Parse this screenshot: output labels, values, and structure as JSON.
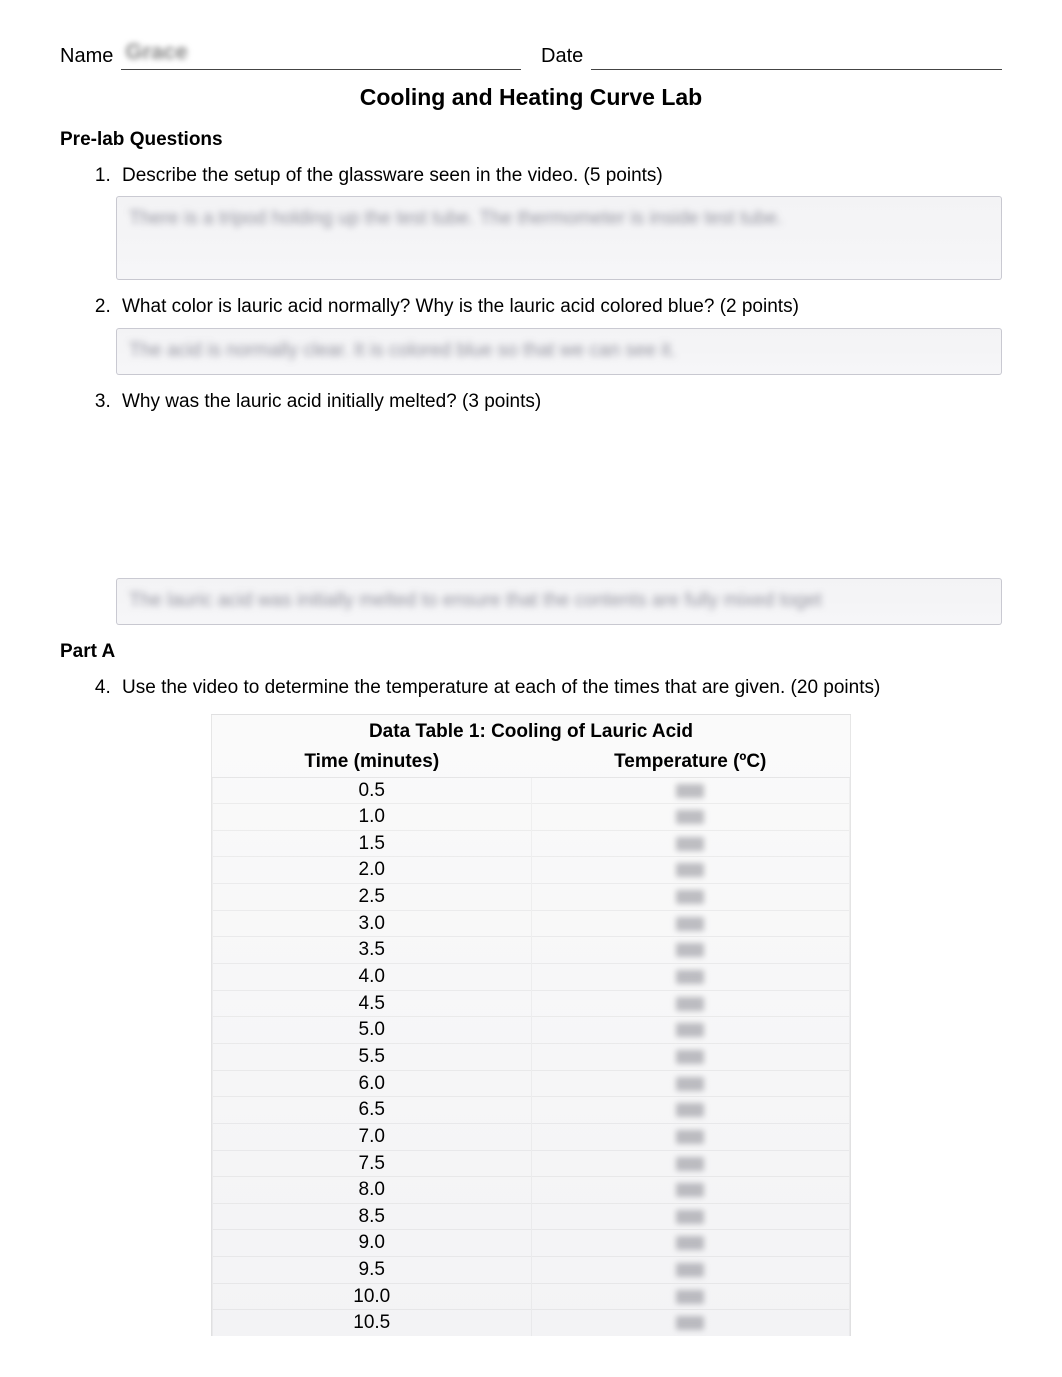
{
  "header": {
    "name_label": "Name",
    "name_value": "Grace",
    "date_label": "Date",
    "date_value": ""
  },
  "title": "Cooling and Heating Curve Lab",
  "sections": {
    "prelab_heading": "Pre-lab Questions",
    "parta_heading": "Part A"
  },
  "questions": {
    "q1": {
      "text": "Describe the setup of the glassware seen in the video. (5 points)",
      "answer": "There is a tripod holding up the test tube. The thermometer is inside test tube."
    },
    "q2": {
      "text": "What color is lauric acid normally? Why is the lauric acid colored blue? (2 points)",
      "answer": "The acid is normally clear. It is colored blue so that we can see it."
    },
    "q3": {
      "text": "Why was the lauric acid initially melted? (3 points)",
      "answer": "The lauric acid was initially melted to ensure that the contents are fully mixed toget"
    },
    "q4": {
      "text": "Use the video to determine the temperature at each of the times that are given. (20 points)"
    }
  },
  "table": {
    "title": "Data Table 1: Cooling of Lauric Acid",
    "col_time": "Time (minutes)",
    "col_temp": "Temperature (ºC)",
    "rows": [
      {
        "time": "0.5",
        "temp": ""
      },
      {
        "time": "1.0",
        "temp": ""
      },
      {
        "time": "1.5",
        "temp": ""
      },
      {
        "time": "2.0",
        "temp": ""
      },
      {
        "time": "2.5",
        "temp": ""
      },
      {
        "time": "3.0",
        "temp": ""
      },
      {
        "time": "3.5",
        "temp": ""
      },
      {
        "time": "4.0",
        "temp": ""
      },
      {
        "time": "4.5",
        "temp": ""
      },
      {
        "time": "5.0",
        "temp": ""
      },
      {
        "time": "5.5",
        "temp": ""
      },
      {
        "time": "6.0",
        "temp": ""
      },
      {
        "time": "6.5",
        "temp": ""
      },
      {
        "time": "7.0",
        "temp": ""
      },
      {
        "time": "7.5",
        "temp": ""
      },
      {
        "time": "8.0",
        "temp": ""
      },
      {
        "time": "8.5",
        "temp": ""
      },
      {
        "time": "9.0",
        "temp": ""
      },
      {
        "time": "9.5",
        "temp": ""
      },
      {
        "time": "10.0",
        "temp": ""
      },
      {
        "time": "10.5",
        "temp": ""
      }
    ]
  }
}
